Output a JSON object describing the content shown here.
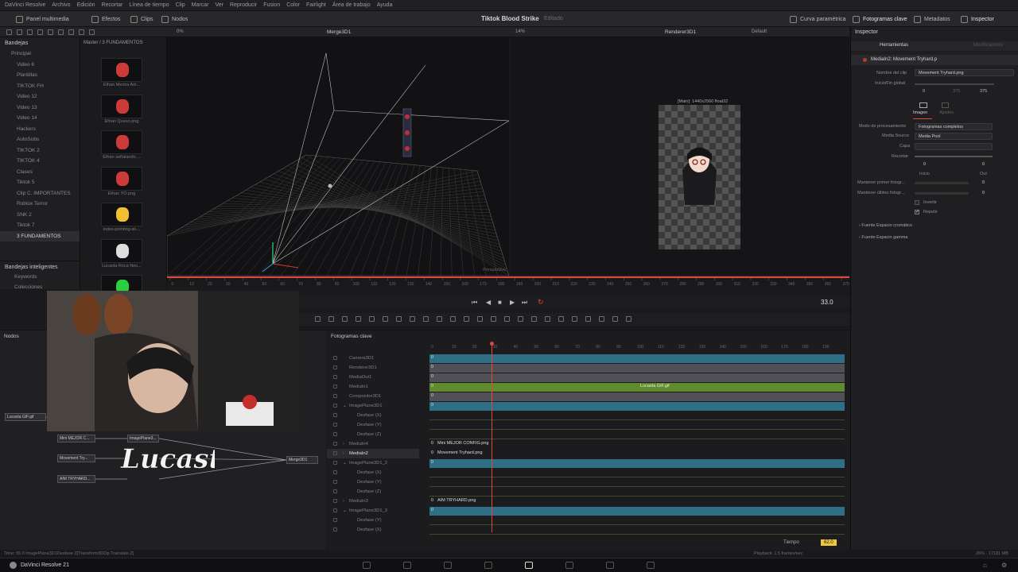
{
  "menu": [
    "DaVinci Resolve",
    "Archivo",
    "Edición",
    "Recortar",
    "Línea de tiempo",
    "Clip",
    "Marcar",
    "Ver",
    "Reproducir",
    "Fusion",
    "Color",
    "Fairlight",
    "Área de trabajo",
    "Ayuda"
  ],
  "toolbar": {
    "media_panel": "Panel multimedia",
    "effects": "Efectos",
    "clips": "Clips",
    "nodes": "Nodos",
    "project_title": "Tiktok Blood Strike",
    "edited": "Editado",
    "param_curve": "Curva paramétrica",
    "keyframes": "Fotogramas clave",
    "metadata": "Metadatos",
    "inspector": "Inspector"
  },
  "subbar": {
    "zoom_left": "0%",
    "merge_title": "Merge3D1",
    "zoom_right": "14%",
    "renderer_title": "Renderer3D1",
    "default": "Default"
  },
  "sidebar": {
    "bins_label": "Bandejas",
    "principal": "Principal",
    "items": [
      "Video 6",
      "Plantillas",
      "TIKTOK FH",
      "Video 12",
      "Video 13",
      "Video 14",
      "Hackers",
      "AutoSubs",
      "TIKTOK 2",
      "TIKTOK 4",
      "Clases",
      "Tiktok 5",
      "Clip C. IMPORTANTES",
      "Roblox Terror",
      "SNK 2",
      "Tiktok 7",
      "3 FUNDAMENTOS"
    ],
    "smart_bins": "Bandejas inteligentes",
    "keywords": "Keywords",
    "collections": "Colecciones"
  },
  "mediapool": {
    "path": "Master / 3 FUNDAMENTOS",
    "clips": [
      "Ethan Menos Ani...",
      "Ethan Queso.png",
      "Ethan señalando....",
      "Ethan YO.png",
      "index-pointing-at-...",
      "Lucasta Roca Neu...",
      ""
    ]
  },
  "viewer": {
    "perspective": "Perspectiva",
    "render_info": "[Main]: 1440x2560 float32"
  },
  "ruler_ticks": [
    "0",
    "10",
    "20",
    "30",
    "40",
    "50",
    "60",
    "70",
    "80",
    "90",
    "100",
    "110",
    "120",
    "130",
    "140",
    "150",
    "160",
    "170",
    "180",
    "190",
    "200",
    "210",
    "220",
    "230",
    "240",
    "250",
    "260",
    "270",
    "280",
    "290",
    "300",
    "310",
    "320",
    "330",
    "340",
    "350",
    "360",
    "370"
  ],
  "transport": {
    "frame": "33.0"
  },
  "inspector": {
    "title": "Inspector",
    "tab_tools": "Herramientas",
    "tab_modifiers": "Modificadores",
    "node_name": "MediaIn2: Movement Tryhard.p",
    "clip_name_label": "Nombre del clip",
    "clip_name": "Movement Tryhard.png",
    "global_label": "Inicio/Fin global",
    "global_start": "0",
    "global_mid": "375",
    "global_end": "375",
    "tab_image": "Imagen",
    "tab_settings": "Ajustes",
    "proc_mode_label": "Modo de procesamiento",
    "proc_mode": "Fotogramas completos",
    "media_source_label": "Media Source",
    "media_source": "Media Pool",
    "layer_label": "Capa",
    "trim_label": "Recortar",
    "trim_in": "0",
    "trim_out": "0",
    "trim_in_label": "Inicio",
    "trim_out_label": "Out",
    "hold_first_label": "Mantener primer fotogr...",
    "hold_first": "0",
    "hold_last_label": "Mantener último fotogr...",
    "hold_last": "0",
    "reverse": "Invertir",
    "loop": "Repetir",
    "color_space": "Fuente Espacio cromático",
    "gamma_space": "Fuente Espacio gamma"
  },
  "nodes_panel": {
    "title": "Nodos",
    "nodes": [
      "Lucasta GIF.gif",
      "Mini MEJOR C...",
      "Movement Try...",
      "AIM TRYHARD...",
      "ImagePlane3...",
      "Merge3D1"
    ]
  },
  "keyframes": {
    "title": "Fotogramas clave",
    "rows": [
      "Camera3D1",
      "Renderer3D1",
      "MediaOut1",
      "MediaIn1",
      "Compositor3D1",
      "ImagePlane3D1",
      "Desfase (X)",
      "Desfase (Y)",
      "Desfase (Z)",
      "MediaIn4",
      "MediaIn2",
      "ImagePlane3D1_2",
      "Desfase (X)",
      "Desfase (Y)",
      "Desfase (Z)",
      "MediaIn3",
      "ImagePlane3D1_3",
      "Desfase (Y)",
      "Desfase (X)"
    ],
    "ruler": [
      "0",
      "10",
      "20",
      "30",
      "40",
      "50",
      "60",
      "70",
      "80",
      "90",
      "100",
      "110",
      "120",
      "130",
      "140",
      "150",
      "160",
      "170",
      "180",
      "190"
    ],
    "clip_labels": {
      "medialn1": "Lucasta GIF.gif",
      "medialn4": "Mini MEJOR CONFIG.png",
      "medialn2": "Movement Tryhard.png",
      "medialn3": "AIM TRYHARD.png"
    },
    "zero": "0",
    "time_label": "Tiempo",
    "time_value": "62.0"
  },
  "status": {
    "left": "Time: 55.0     ImagePlane3D1Desfase Z[Transform3DOp.Translate.Z]",
    "playback": "Playback: 1.5 frames/sec",
    "mem": "26% · 17181 MB"
  },
  "footer": {
    "app": "DaVinci Resolve 21"
  },
  "overlay": {
    "logo_text": "Lucasta"
  },
  "colors": {
    "accent_red": "#e0463c",
    "track_teal": "#2f6f86",
    "track_green": "#5f8b2c",
    "bg": "#1a1a1c"
  }
}
